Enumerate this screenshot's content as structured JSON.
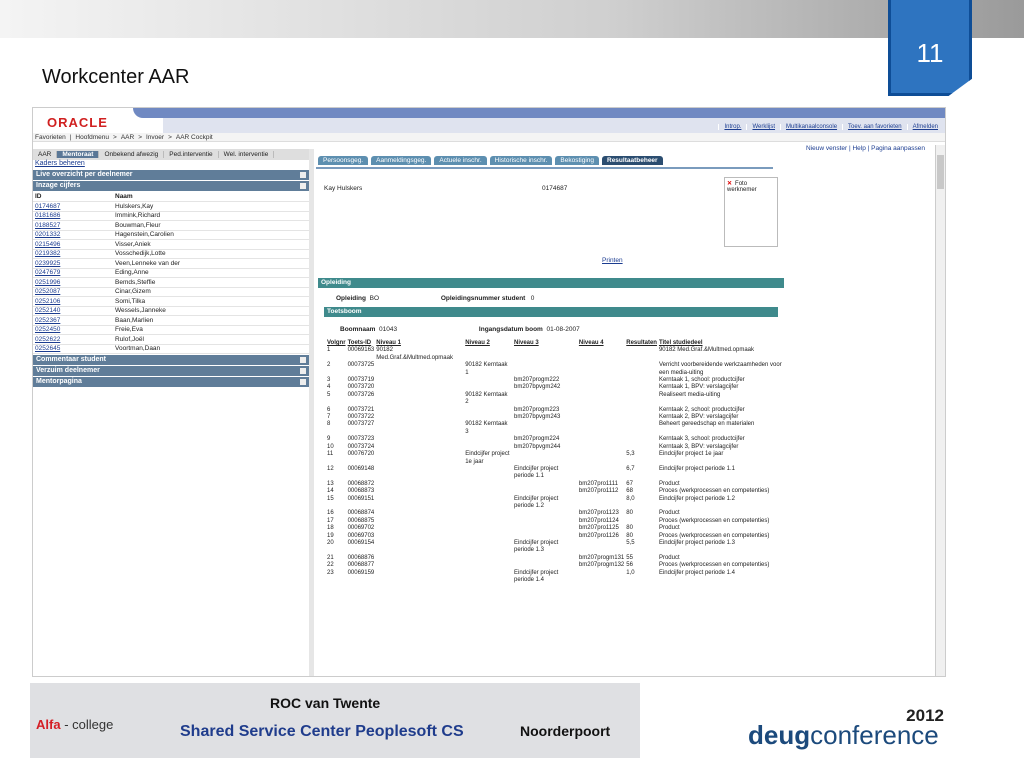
{
  "slide": {
    "number": "11",
    "title": "Workcenter AAR"
  },
  "app": {
    "logo": "ORACLE",
    "top_links": [
      "Introp.",
      "Werklijst",
      "Multikanaalconsole",
      "Toev. aan favorieten",
      "Afmelden"
    ],
    "breadcrumb": [
      "Favorieten",
      "|",
      "Hoofdmenu",
      ">",
      "AAR",
      ">",
      "Invoer",
      ">",
      "AAR Cockpit"
    ],
    "left_tabs": [
      "AAR",
      "Mentoraat",
      "Onbekend afwezig",
      "Ped.interventie",
      "Wel. interventie"
    ],
    "left_tab_active": "Mentoraat",
    "kaders_link": "Kaders beheren",
    "sections": {
      "live": "Live overzicht per deelnemer",
      "inzage": "Inzage cijfers",
      "commentaar": "Commentaar student",
      "verzuim": "Verzuim deelnemer",
      "mentorpagina": "Mentorpagina"
    },
    "students_header": {
      "id": "ID",
      "naam": "Naam"
    },
    "students": [
      {
        "id": "0174687",
        "naam": "Hulskers,Kay"
      },
      {
        "id": "0181686",
        "naam": "Immink,Richard"
      },
      {
        "id": "0188527",
        "naam": "Bouwman,Fleur"
      },
      {
        "id": "0201332",
        "naam": "Hagenstein,Carolien"
      },
      {
        "id": "0215496",
        "naam": "Visser,Aniek"
      },
      {
        "id": "0219382",
        "naam": "Vosschedijk,Lotte"
      },
      {
        "id": "0239925",
        "naam": "Veen,Lenneke van der"
      },
      {
        "id": "0247679",
        "naam": "Eding,Anne"
      },
      {
        "id": "0251996",
        "naam": "Bemds,Steffie"
      },
      {
        "id": "0252087",
        "naam": "Cinar,Gizem"
      },
      {
        "id": "0252106",
        "naam": "Somi,Tilka"
      },
      {
        "id": "0252140",
        "naam": "Wessels,Janneke"
      },
      {
        "id": "0252367",
        "naam": "Baan,Marlien"
      },
      {
        "id": "0252450",
        "naam": "Freie,Eva"
      },
      {
        "id": "0252622",
        "naam": "Rulof,Joël"
      },
      {
        "id": "0252645",
        "naam": "Voortman,Daan"
      }
    ],
    "right_links": "Nieuw venster | Help | Pagina aanpassen",
    "right_tabs": [
      "Persoonsgeg.",
      "Aanmeldingsgeg.",
      "Actuele inschr.",
      "Historische inschr.",
      "Bekostiging",
      "Resultaatbeheer"
    ],
    "right_tab_active": "Resultaatbeheer",
    "student_name": "Kay Hulskers",
    "student_id": "0174687",
    "foto_label": "Foto werknemer",
    "printen": "Printen",
    "opleiding_header": "Opleiding",
    "opleiding_label": "Opleiding",
    "opleiding_value": "BO",
    "oplnr_label": "Opleidingsnummer student",
    "oplnr_value": "0",
    "toetsboom_header": "Toetsboom",
    "boomnaam_label": "Boomnaam",
    "boomnaam_value": "01043",
    "ingang_label": "Ingangsdatum boom",
    "ingang_value": "01-08-2007",
    "table_headers": [
      "Volgnr",
      "Toets-ID",
      "Niveau 1",
      "Niveau 2",
      "Niveau 3",
      "Niveau 4",
      "Resultaten",
      "Titel studiedeel"
    ],
    "rows": [
      [
        "1",
        "00069163",
        "90182 Med.Graf.&Multmed.opmaak",
        "",
        "",
        "",
        "",
        "90182 Med.Graf.&Multmed.opmaak"
      ],
      [
        "2",
        "00073725",
        "",
        "90182 Kerntaak 1",
        "",
        "",
        "",
        "Verricht voorbereidende werkzaamheden voor een media-uiting"
      ],
      [
        "3",
        "00073719",
        "",
        "",
        "bm207progm222",
        "",
        "",
        "Kerntaak 1, school: productcijfer"
      ],
      [
        "4",
        "00073720",
        "",
        "",
        "bm207bpvgm242",
        "",
        "",
        "Kerntaak 1, BPV: verslagcijfer"
      ],
      [
        "5",
        "00073726",
        "",
        "90182 Kerntaak 2",
        "",
        "",
        "",
        "Realiseert media-uiting"
      ],
      [
        "6",
        "00073721",
        "",
        "",
        "bm207progm223",
        "",
        "",
        "Kerntaak 2, school: productcijfer"
      ],
      [
        "7",
        "00073722",
        "",
        "",
        "bm207bpvgm243",
        "",
        "",
        "Kerntaak 2, BPV: verslagcijfer"
      ],
      [
        "8",
        "00073727",
        "",
        "90182 Kerntaak 3",
        "",
        "",
        "",
        "Beheert gereedschap en materialen"
      ],
      [
        "9",
        "00073723",
        "",
        "",
        "bm207progm224",
        "",
        "",
        "Kerntaak 3, school: productcijfer"
      ],
      [
        "10",
        "00073724",
        "",
        "",
        "bm207bpvgm244",
        "",
        "",
        "Kerntaak 3, BPV: verslagcijfer"
      ],
      [
        "11",
        "00076720",
        "",
        "Eindcijfer project 1e jaar",
        "",
        "",
        "5,3",
        "Eindcijfer project 1e jaar"
      ],
      [
        "12",
        "00069148",
        "",
        "",
        "Eindcijfer project periode 1.1",
        "",
        "6,7",
        "Eindcijfer project periode 1.1"
      ],
      [
        "13",
        "00068872",
        "",
        "",
        "",
        "bm207pro1111",
        "67",
        "Product"
      ],
      [
        "14",
        "00068873",
        "",
        "",
        "",
        "bm207pro1112",
        "68",
        "Proces (werkprocessen en competenties)"
      ],
      [
        "15",
        "00069151",
        "",
        "",
        "Eindcijfer project periode 1.2",
        "",
        "8,0",
        "Eindcijfer project periode 1.2"
      ],
      [
        "16",
        "00068874",
        "",
        "",
        "",
        "bm207pro1123",
        "80",
        "Product"
      ],
      [
        "17",
        "00068875",
        "",
        "",
        "",
        "bm207pro1124",
        "",
        "Proces (werkprocessen en competenties)"
      ],
      [
        "18",
        "00069702",
        "",
        "",
        "",
        "bm207pro1125",
        "80",
        "Product"
      ],
      [
        "19",
        "00069703",
        "",
        "",
        "",
        "bm207pro1126",
        "80",
        "Proces (werkprocessen en competenties)"
      ],
      [
        "20",
        "00069154",
        "",
        "",
        "Eindcijfer project periode 1.3",
        "",
        "5,5",
        "Eindcijfer project periode 1.3"
      ],
      [
        "21",
        "00068876",
        "",
        "",
        "",
        "bm207progm131",
        "55",
        "Product"
      ],
      [
        "22",
        "00068877",
        "",
        "",
        "",
        "bm207progm132",
        "56",
        "Proces (werkprocessen en competenties)"
      ],
      [
        "23",
        "00069159",
        "",
        "",
        "Eindcijfer project periode 1.4",
        "",
        "1,0",
        "Eindcijfer project periode 1.4"
      ]
    ]
  },
  "footer": {
    "roc": "ROC van Twente",
    "alfa": "Alfa",
    "alfa_college": "- college",
    "ssc": "Shared Service Center Peoplesoft CS",
    "noorderpoort": "Noorderpoort"
  },
  "deug": {
    "year": "2012",
    "deug": "deug",
    "conference": "conference"
  }
}
